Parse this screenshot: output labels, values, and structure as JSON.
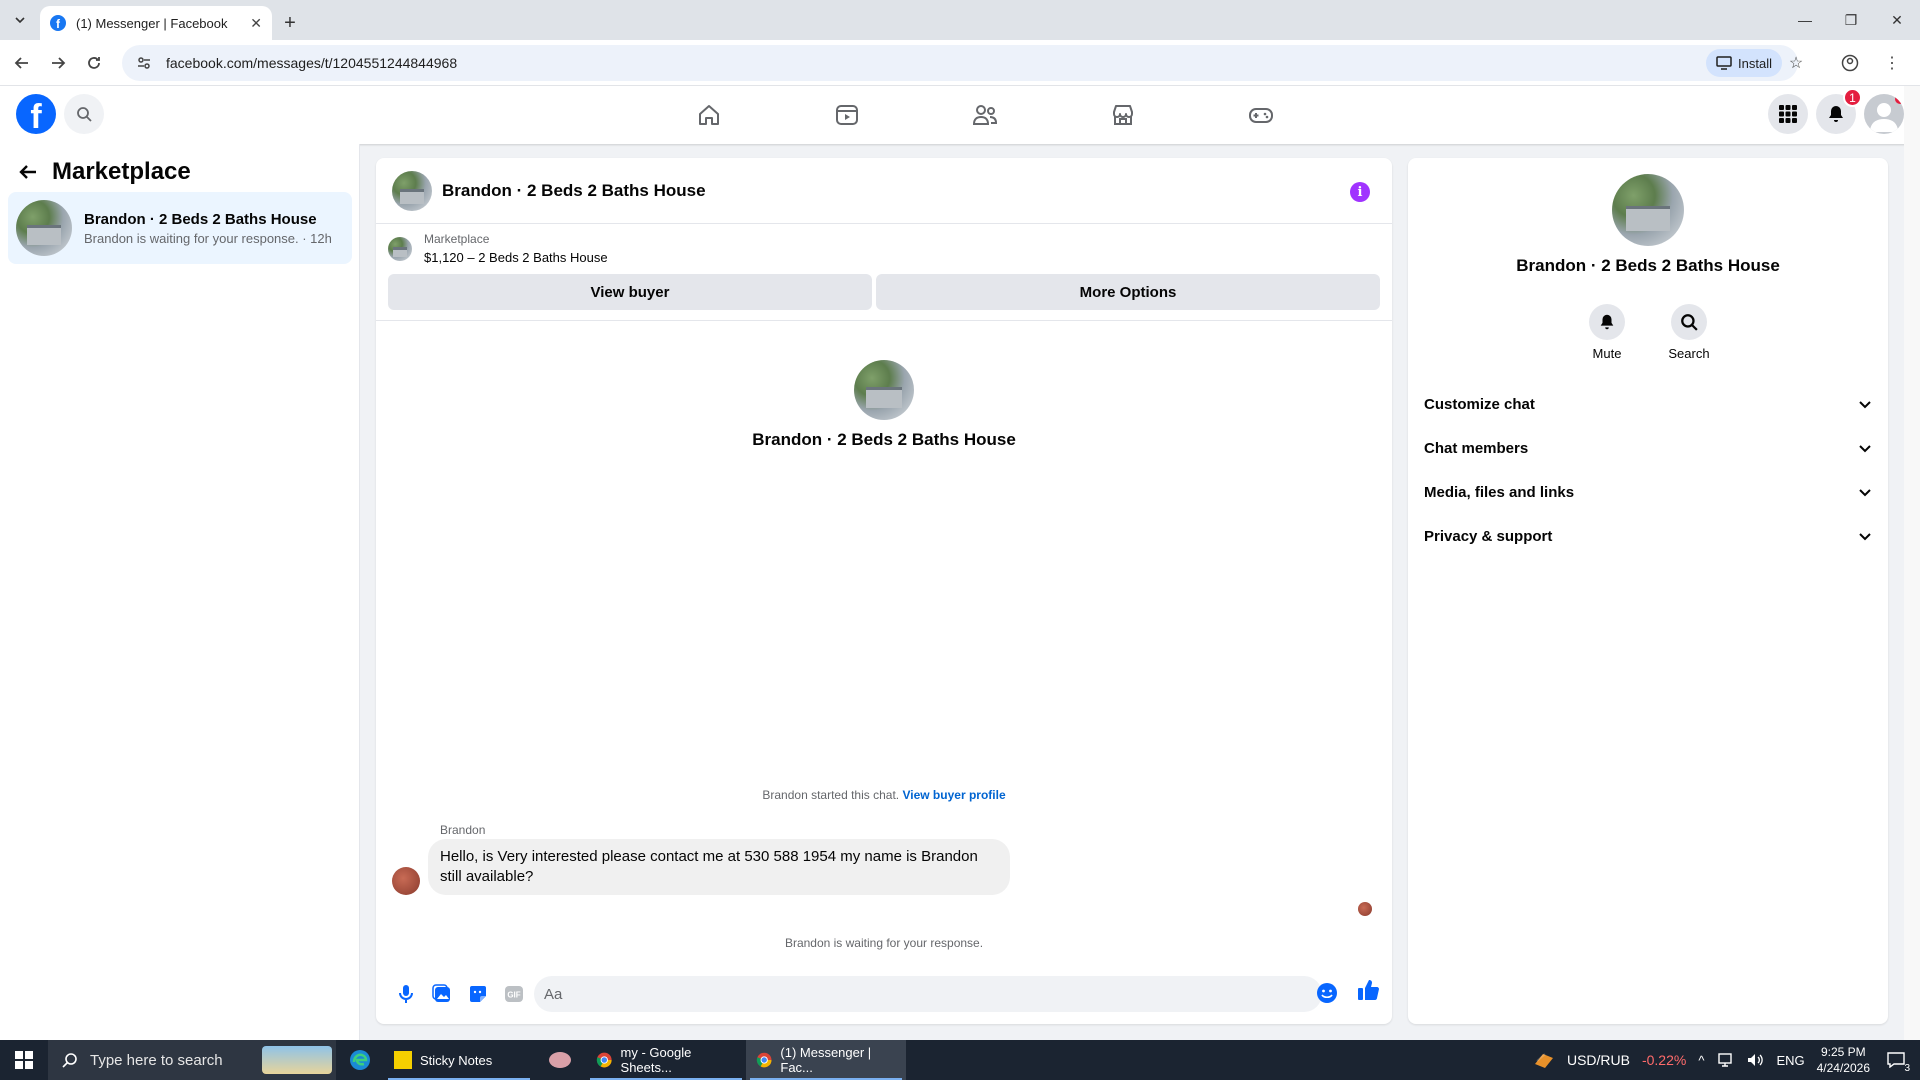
{
  "browser": {
    "tab_title": "(1) Messenger | Facebook",
    "url": "facebook.com/messages/t/1204551244844968",
    "install_label": "Install"
  },
  "facebook": {
    "notifications_count": "1"
  },
  "sidebar": {
    "title": "Marketplace",
    "conversations": [
      {
        "name": "Brandon · 2 Beds 2 Baths House",
        "preview": "Brandon is waiting for your response. · 12h"
      }
    ]
  },
  "chat": {
    "header_title": "Brandon · 2 Beds 2 Baths House",
    "listing_source": "Marketplace",
    "listing_title": "$1,120 – 2 Beds 2 Baths House",
    "view_buyer_label": "View buyer",
    "more_options_label": "More Options",
    "profile_name": "Brandon · 2 Beds 2 Baths House",
    "started_text": "Brandon started this chat.",
    "view_buyer_profile_label": "View buyer profile",
    "messages": [
      {
        "sender": "Brandon",
        "text": "Hello, is Very interested please contact me at 530 588 1954 my name is Brandon still available?"
      }
    ],
    "waiting_text": "Brandon is waiting for your response.",
    "composer_placeholder": "Aa"
  },
  "info_pane": {
    "name": "Brandon · 2 Beds 2 Baths House",
    "actions": [
      {
        "label": "Mute",
        "icon": "bell-icon"
      },
      {
        "label": "Search",
        "icon": "search-icon"
      }
    ],
    "sections": [
      {
        "label": "Customize chat"
      },
      {
        "label": "Chat members"
      },
      {
        "label": "Media, files and links"
      },
      {
        "label": "Privacy & support"
      }
    ]
  },
  "taskbar": {
    "search_placeholder": "Type here to search",
    "apps": [
      {
        "label": "Sticky Notes"
      },
      {
        "label": "my - Google Sheets..."
      },
      {
        "label": "(1) Messenger | Fac..."
      }
    ],
    "currency_pair": "USD/RUB",
    "currency_change": "-0.22%",
    "language": "ENG",
    "time": "9:25 PM",
    "date": "4/24/2026",
    "notification_count": "3"
  },
  "colors": {
    "facebook_blue": "#0866ff",
    "link_blue": "#0064d1",
    "info_purple": "#a033ff",
    "badge_red": "#e41e3f",
    "currency_change_red": "#ff6b6b"
  }
}
